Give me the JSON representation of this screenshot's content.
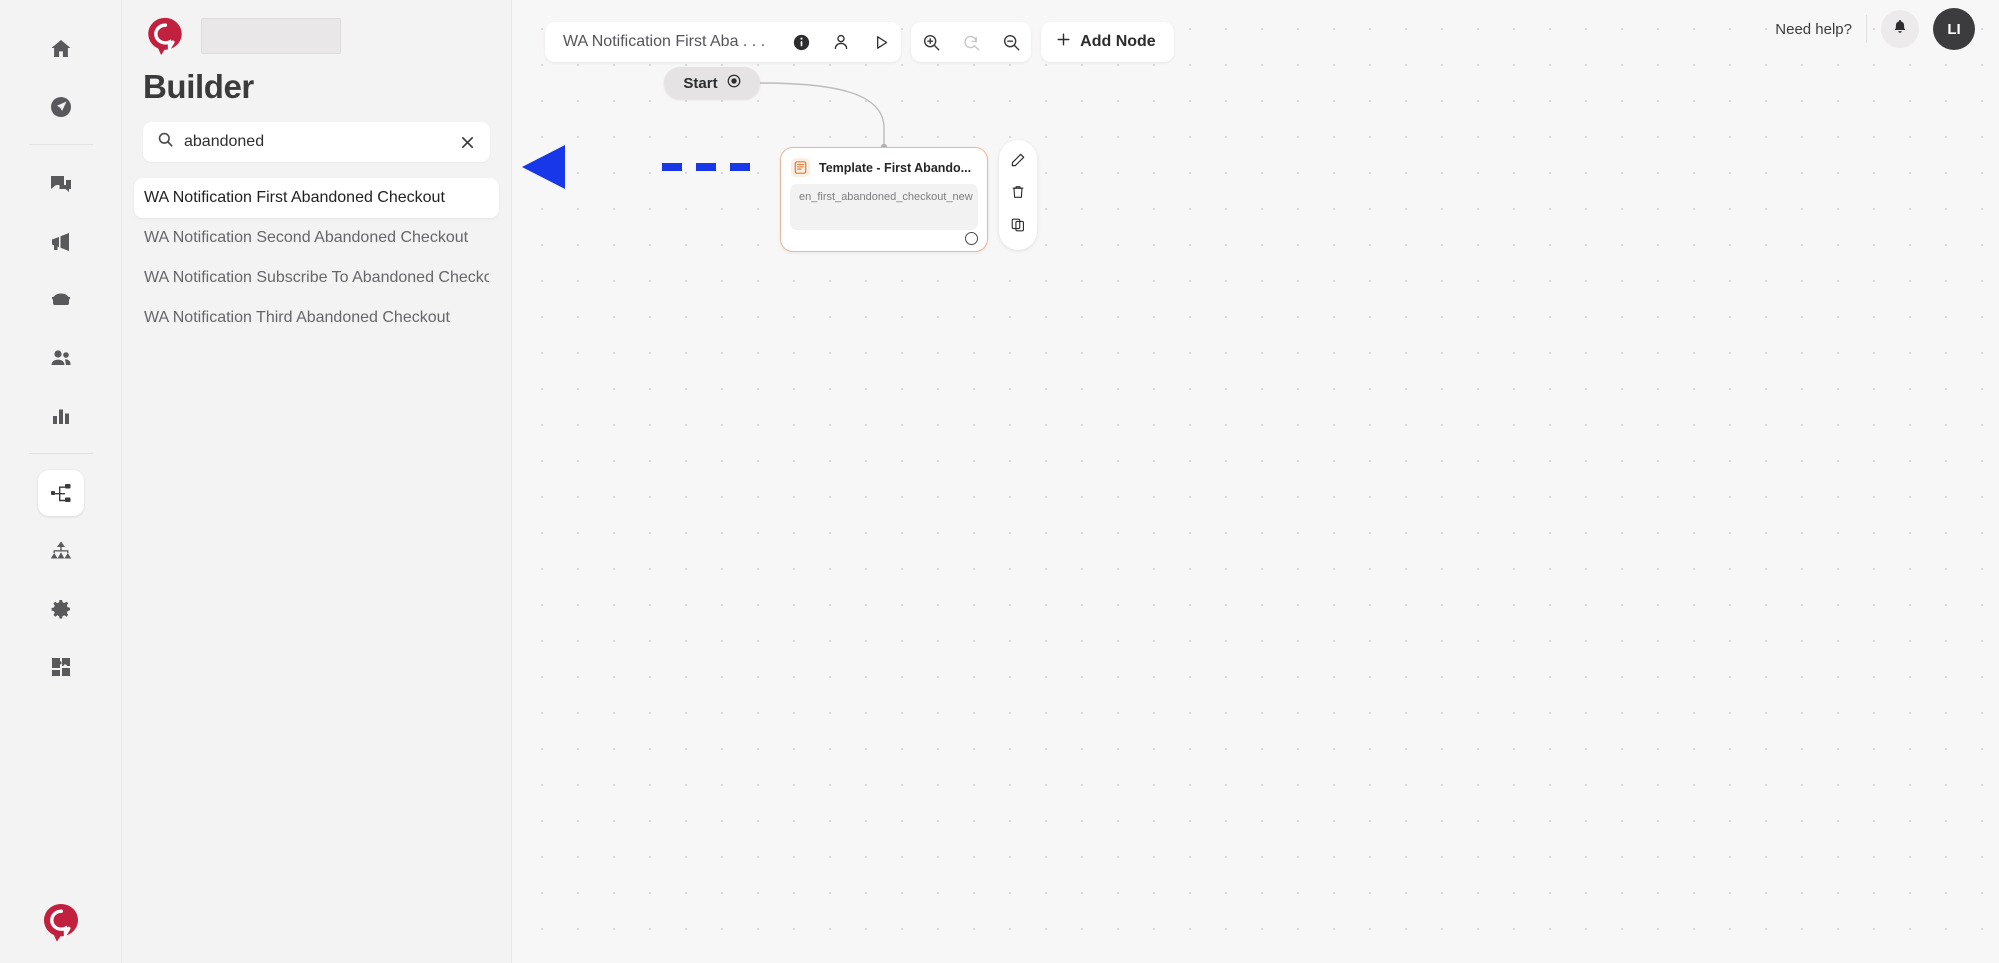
{
  "rail": {
    "items": [
      {
        "name": "home-icon",
        "label": "Home",
        "active": false
      },
      {
        "name": "send-icon",
        "label": "Campaigns",
        "active": false
      },
      {
        "name": "chat-icon",
        "label": "Conversations",
        "active": false
      },
      {
        "name": "megaphone-icon",
        "label": "Broadcast",
        "active": false
      },
      {
        "name": "inbox-icon",
        "label": "Inbox",
        "active": false
      },
      {
        "name": "contacts-icon",
        "label": "Contacts",
        "active": false
      },
      {
        "name": "analytics-icon",
        "label": "Analytics",
        "active": false
      },
      {
        "name": "flow-builder-icon",
        "label": "Builder",
        "active": true
      },
      {
        "name": "org-chart-icon",
        "label": "Teams",
        "active": false
      },
      {
        "name": "gear-icon",
        "label": "Settings",
        "active": false
      },
      {
        "name": "puzzle-icon",
        "label": "Integrations",
        "active": false
      }
    ]
  },
  "sidebar": {
    "title": "Builder",
    "search": {
      "value": "abandoned",
      "placeholder": "Search",
      "clear_label": "✕"
    },
    "flows": [
      {
        "label": "WA Notification First Abandoned Checkout",
        "selected": true
      },
      {
        "label": "WA Notification Second Abandoned Checkout",
        "selected": false
      },
      {
        "label": "WA Notification Subscribe To Abandoned Checkout",
        "selected": false
      },
      {
        "label": "WA Notification Third Abandoned Checkout",
        "selected": false
      }
    ]
  },
  "toolbar": {
    "flow_name": "WA Notification First Aba . . .",
    "info_label": "Info",
    "assign_label": "Assign",
    "run_label": "Run",
    "zoom_in_label": "Zoom in",
    "reset_label": "Reset view",
    "zoom_out_label": "Zoom out",
    "add_node_label": "Add Node",
    "add_node_plus": "+"
  },
  "header": {
    "need_help": "Need help?",
    "avatar_initials": "LI"
  },
  "canvas": {
    "start_node": {
      "label": "Start"
    },
    "template_node": {
      "title": "Template - First Abando...",
      "body_text": "en_first_abandoned_checkout_new",
      "border_color": "#e6b89c"
    },
    "node_actions": [
      {
        "name": "edit-icon",
        "label": "Edit"
      },
      {
        "name": "delete-icon",
        "label": "Delete"
      },
      {
        "name": "duplicate-icon",
        "label": "Duplicate"
      }
    ],
    "annotation": {
      "type": "dashed-arrow-left",
      "color": "#1737e8"
    }
  },
  "colors": {
    "brand_red": "#c2203f",
    "accent_orange": "#e6b89c",
    "annotation_blue": "#1737e8",
    "canvas_bg": "#f8f7f7",
    "panel_bg": "#f4f3f3"
  }
}
